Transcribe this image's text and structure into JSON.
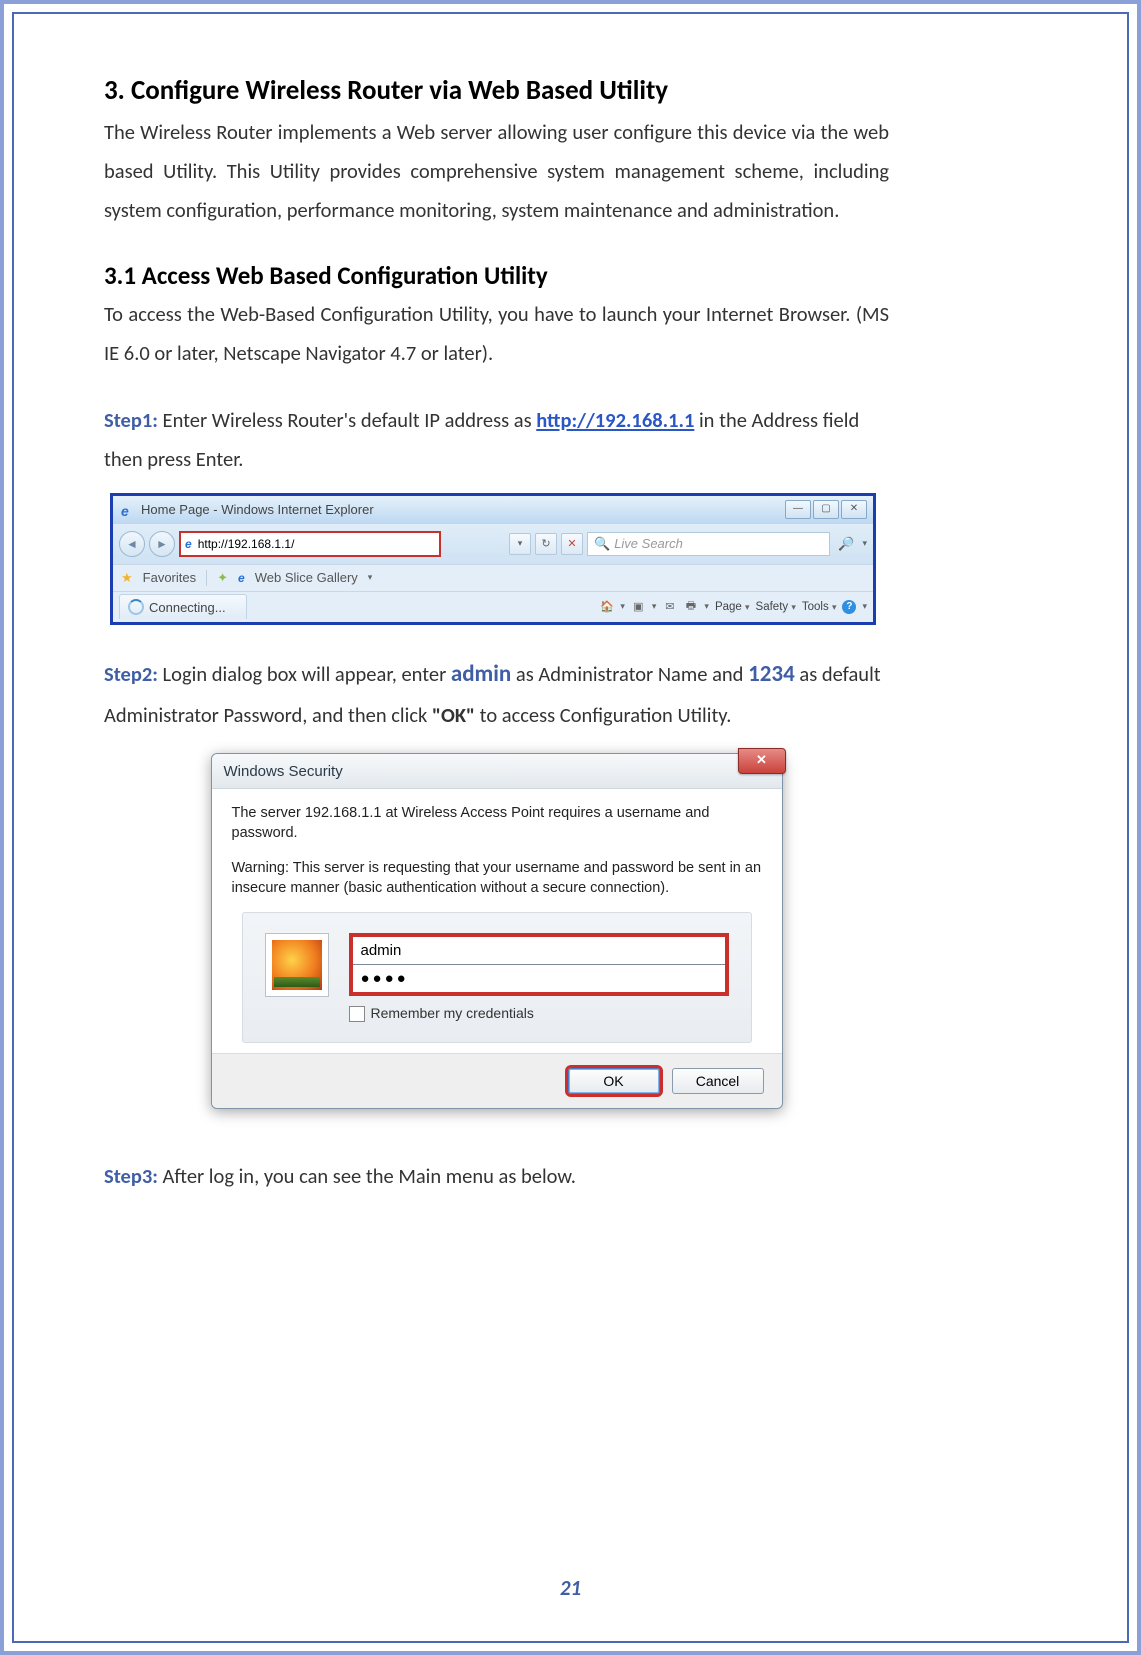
{
  "doc": {
    "section_title": "3. Configure Wireless Router via Web Based Utility",
    "section_body": "The Wireless Router implements a Web server allowing user configure this device via the web based Utility. This Utility provides comprehensive system management scheme, including system configuration, performance monitoring, system maintenance and administration.",
    "subsection_title": "3.1 Access Web Based Configuration Utility",
    "subsection_body": "To access the Web-Based Configuration Utility, you have to launch your Internet Browser. (MS IE 6.0 or later, Netscape Navigator 4.7 or later).",
    "step1_label": "Step1:",
    "step1_before_link": " Enter Wireless Router's default IP address as ",
    "step1_link": "http://192.168.1.1",
    "step1_after_link": " in the Address field then press Enter.",
    "step2_label": "Step2:",
    "step2_a": " Login dialog box will appear, enter ",
    "step2_admin": "admin",
    "step2_b": " as Administrator Name and ",
    "step2_pwd": "1234",
    "step2_c": " as default Administrator Password, and then click ",
    "step2_ok": "\"OK\"",
    "step2_d": " to access Configuration Utility.",
    "step3_label": "Step3:",
    "step3_text": " After log in, you can see the Main menu as below.",
    "page_number": "21"
  },
  "ie": {
    "window_title": "Home Page - Windows Internet Explorer",
    "address_value": "http://192.168.1.1/",
    "search_placeholder": "Live Search",
    "favorites_label": "Favorites",
    "webslice_label": "Web Slice Gallery",
    "tab_label": "Connecting...",
    "tools": {
      "page": "Page",
      "safety": "Safety",
      "tools": "Tools"
    },
    "win_buttons": {
      "min": "—",
      "max": "▢",
      "close": "✕"
    }
  },
  "security": {
    "title": "Windows Security",
    "msg1": "The server 192.168.1.1 at Wireless Access Point requires a username and password.",
    "msg2": "Warning: This server is requesting that your username and password be sent in an insecure manner (basic authentication without a secure connection).",
    "username_value": "admin",
    "password_masked": "●●●●",
    "remember_label": "Remember my credentials",
    "ok_label": "OK",
    "cancel_label": "Cancel",
    "close_x": "✕"
  }
}
